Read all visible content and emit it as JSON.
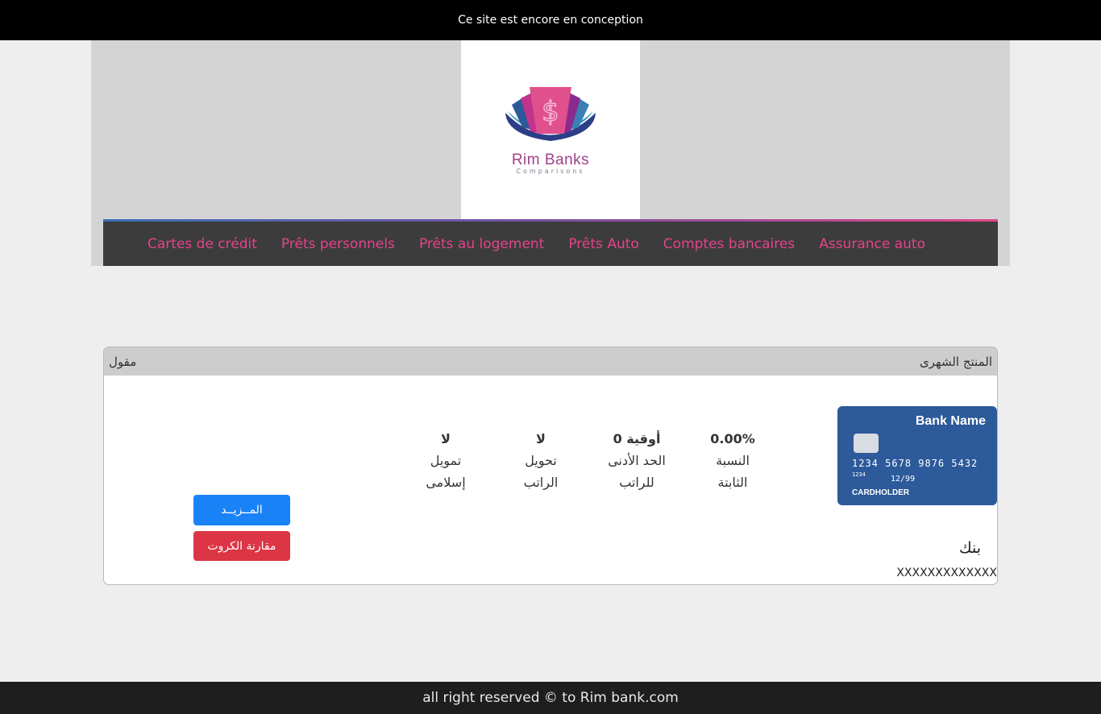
{
  "topbar": {
    "notice": "Ce site est encore en conception"
  },
  "logo": {
    "title": "Rim Banks",
    "subtitle": "Comparisons"
  },
  "nav": {
    "items": [
      {
        "label": "Cartes de crédit"
      },
      {
        "label": "Prêts personnels"
      },
      {
        "label": "Prêts au logement"
      },
      {
        "label": "Prêts Auto"
      },
      {
        "label": "Comptes bancaires"
      },
      {
        "label": "Assurance auto"
      }
    ],
    "color": "#e4438a"
  },
  "product": {
    "header_right": "المنتج الشهرى",
    "header_left": "مقول",
    "card": {
      "bank_name": "Bank Name",
      "number": "1234 5678 9876 5432",
      "small_number": "1234",
      "valid_thru": "12/99",
      "holder": "CARDHOLDER"
    },
    "stats": [
      {
        "value": "0.00%",
        "label1": "النسبة",
        "label2": "الثابتة"
      },
      {
        "value": "0 أوقية",
        "label1": "الحد الأدنى",
        "label2": "للراتب"
      },
      {
        "value": "لا",
        "label1": "تحويل",
        "label2": "الراتب"
      },
      {
        "value": "لا",
        "label1": "تمويل",
        "label2": "إسلامى"
      }
    ],
    "more_button": "المــزيــد",
    "compare_button": "مقارنة الكروت",
    "bank_label": "بنك",
    "bank_value": "XXXXXXXXXXXXX"
  },
  "footer": {
    "text": "all right reserved © to Rim bank.com"
  }
}
